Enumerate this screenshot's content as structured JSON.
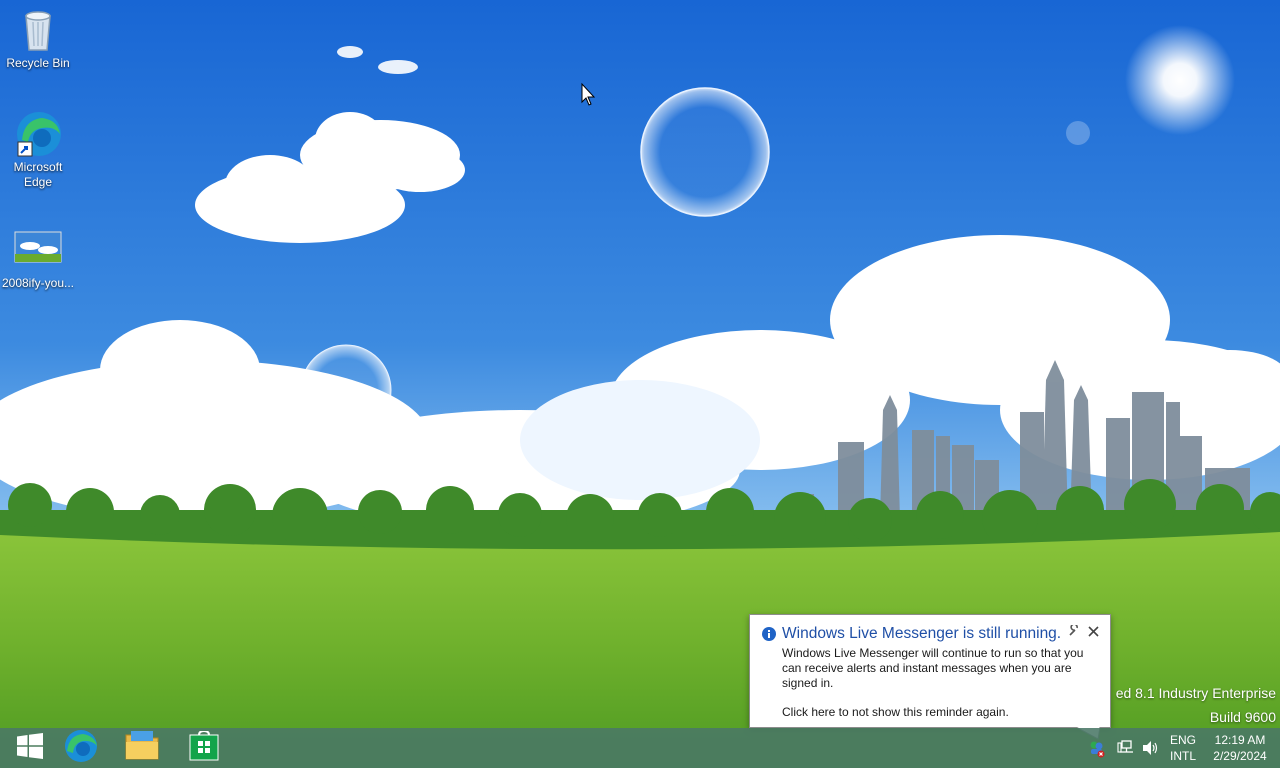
{
  "desktop": {
    "icons": [
      {
        "label": "Recycle Bin",
        "icon": "recycle-bin-icon"
      },
      {
        "label": "Microsoft Edge",
        "icon": "edge-icon"
      },
      {
        "label": "2008ify-you...",
        "icon": "image-file-icon"
      }
    ],
    "watermark": {
      "line1": "ed 8.1 Industry Enterprise",
      "line2": "Build 9600"
    }
  },
  "notification": {
    "title": "Windows Live Messenger is still running.",
    "body": "Windows Live Messenger will continue to run so that you can receive alerts and instant messages when you are signed in.",
    "link": "Click here to not show this reminder again.",
    "icon": "info-icon"
  },
  "taskbar": {
    "pinned": [
      {
        "name": "start",
        "icon": "windows-logo-icon"
      },
      {
        "name": "edge",
        "icon": "edge-icon"
      },
      {
        "name": "file-explorer",
        "icon": "folder-icon"
      },
      {
        "name": "store",
        "icon": "store-icon"
      }
    ],
    "tray": {
      "language_line1": "ENG",
      "language_line2": "INTL",
      "time": "12:19 AM",
      "date": "2/29/2024"
    }
  },
  "colors": {
    "taskbar": "#4a7866",
    "notification_title": "#1f4fa6",
    "sky": "#3d8be0"
  }
}
